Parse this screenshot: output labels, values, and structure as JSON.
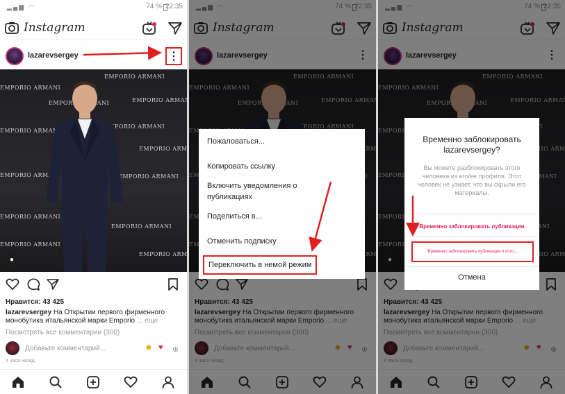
{
  "status": {
    "battery": "74 %",
    "time": "22:35"
  },
  "app": {
    "logo": "Instagram"
  },
  "post": {
    "username": "lazarevsergey",
    "brand_text": "EMPORIO ARMANI",
    "likes": "Нравится: 43 425",
    "caption_user": "lazarevsergey",
    "caption_text": "На Открытии первого фирменного монобутика итальянской марки Emporio",
    "caption_more": "... еще",
    "all_comments": "Посмотреть все комментарии (300)",
    "add_comment": "Добавьте комментарий...",
    "time_ago": "4 часа назад"
  },
  "menu": {
    "items": [
      "Пожаловаться...",
      "Копировать ссылку",
      "Включить уведомления о публикациях",
      "Поделиться в...",
      "Отменить подписку",
      "Переключить в немой режим"
    ]
  },
  "dialog": {
    "title": "Временно заблокировать lazarevsergey?",
    "description": "Вы можете разблокировать этого человека из его/ее профиля. Этот человек не узнает, что вы скрыли его материалы.",
    "option_posts": "Временно заблокировать публикации",
    "option_posts_stories": "Временно заблокировать публикации и исто...",
    "cancel": "Отмена"
  },
  "icons": [
    "camera-icon",
    "igtv-icon",
    "direct-icon",
    "more-icon",
    "heart-icon",
    "comment-icon",
    "share-icon",
    "bookmark-icon",
    "home-icon",
    "search-icon",
    "add-icon",
    "activity-icon",
    "profile-icon"
  ],
  "colors": {
    "highlight": "#e02020",
    "danger": "#e0245e",
    "text": "#262626",
    "muted": "#999999"
  }
}
